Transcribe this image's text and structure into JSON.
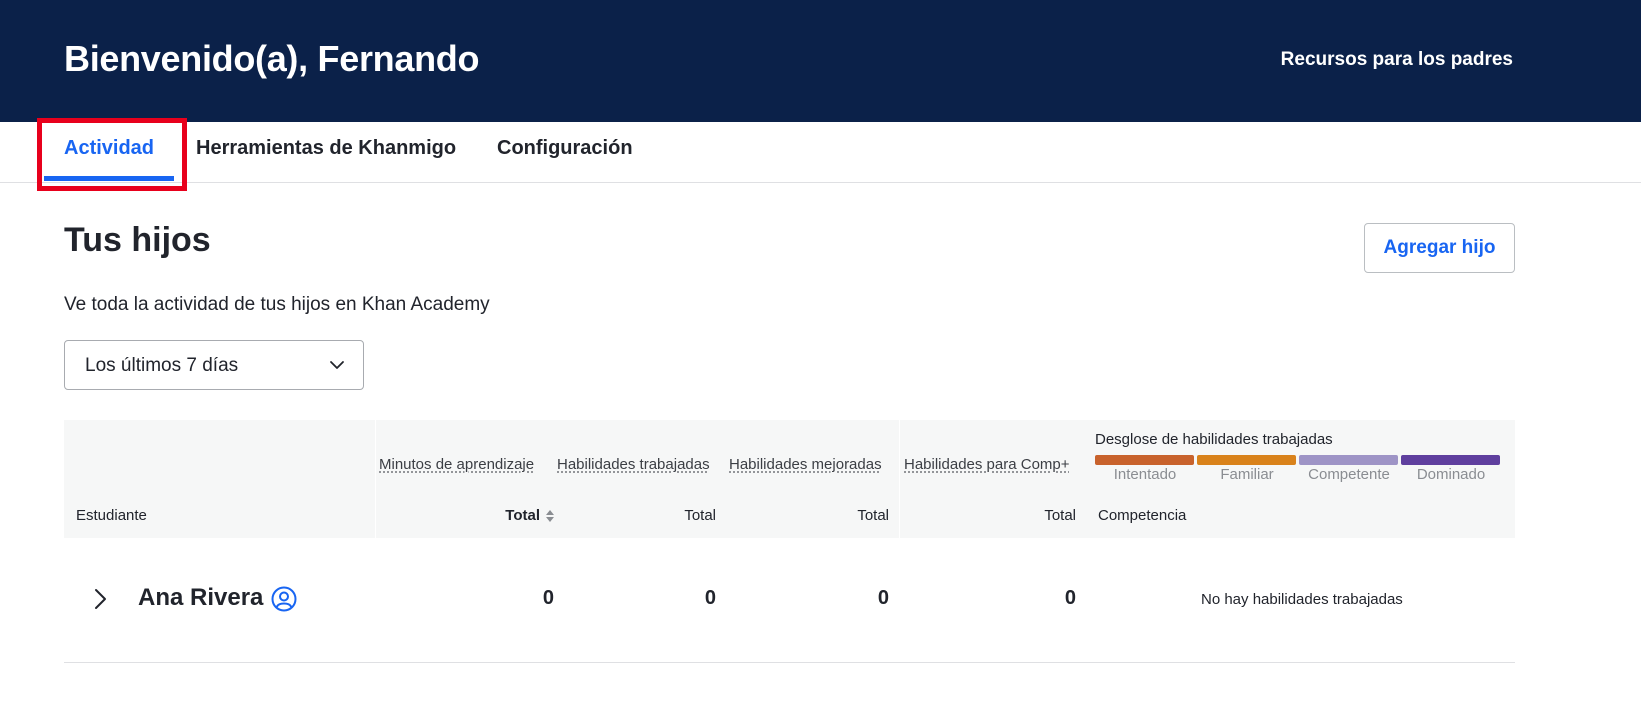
{
  "header": {
    "title": "Bienvenido(a), Fernando",
    "parent_resources": "Recursos para los padres"
  },
  "tabs": [
    {
      "label": "Actividad",
      "active": true
    },
    {
      "label": "Herramientas de Khanmigo",
      "active": false
    },
    {
      "label": "Configuración",
      "active": false
    }
  ],
  "section": {
    "title": "Tus hijos",
    "subtitle": "Ve toda la actividad de tus hijos en Khan Academy",
    "add_button": "Agregar hijo"
  },
  "filter": {
    "selected": "Los últimos 7 días"
  },
  "table": {
    "columns": {
      "student": "Estudiante",
      "minutes": "Minutos de aprendizaje",
      "skills_worked": "Habilidades trabajadas",
      "skills_improved": "Habilidades mejoradas",
      "skills_comp": "Habilidades para Comp+",
      "total": "Total",
      "competency": "Competencia"
    },
    "breakdown": {
      "title": "Desglose de habilidades trabajadas",
      "levels": [
        {
          "label": "Intentado",
          "color": "#c8622c"
        },
        {
          "label": "Familiar",
          "color": "#d9821b"
        },
        {
          "label": "Competente",
          "color": "#9e94c6"
        },
        {
          "label": "Dominado",
          "color": "#5f3f9e"
        }
      ]
    },
    "rows": [
      {
        "name": "Ana Rivera",
        "minutes": "0",
        "skills_worked": "0",
        "skills_improved": "0",
        "skills_comp": "0",
        "competency": "No hay habilidades trabajadas"
      }
    ]
  },
  "colors": {
    "header_bg": "#0b2149",
    "accent": "#1865f2",
    "highlight": "#e8001c"
  },
  "icons": {
    "select": "chevron-down-icon",
    "sort": "sort-icon",
    "expand": "chevron-right-icon",
    "profile": "person-circle-icon"
  }
}
